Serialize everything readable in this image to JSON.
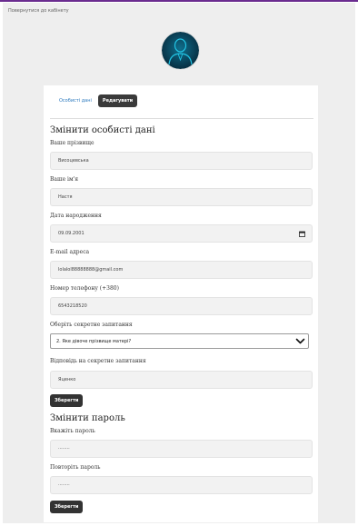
{
  "nav": {
    "back_link": "Повернутися до кабінету"
  },
  "avatar": {
    "icon": "user-avatar-icon",
    "colors": {
      "bg": "#0b3a52",
      "glow": "#18b6d6"
    }
  },
  "tabs": [
    {
      "label": "Особисті дані",
      "active": false
    },
    {
      "label": "Редагувати",
      "active": true
    }
  ],
  "profile_form": {
    "title": "Змінити особисті дані",
    "fields": {
      "surname": {
        "label": "Ваше прізвище",
        "value": "Висоцевська"
      },
      "name": {
        "label": "Ваше ім'я",
        "value": "Настя"
      },
      "birth_date": {
        "label": "Дата народження",
        "value": "09.09.2001"
      },
      "email": {
        "label": "E-mail адреса",
        "value": "lolalol88888888@gmail.com"
      },
      "phone": {
        "label": "Номер телефону (+380)",
        "value": "6543218520"
      },
      "secret_question": {
        "label": "Оберіть секретне запитання",
        "value": "2. Яке дівоче прізвище матері?"
      },
      "secret_answer": {
        "label": "Відповідь на секретне запитання",
        "value": "Яценко"
      }
    },
    "save_label": "Зберегти"
  },
  "password_form": {
    "title": "Змінити пароль",
    "fields": {
      "password": {
        "label": "Вкажіть пароль",
        "value": "········"
      },
      "password_repeat": {
        "label": "Повторіть пароль",
        "value": "········"
      }
    },
    "save_label": "Зберегти"
  },
  "colors": {
    "accent_bar": "#6a2c8f",
    "button": "#333333",
    "link": "#2e7bbf",
    "background": "#eeeeee"
  }
}
